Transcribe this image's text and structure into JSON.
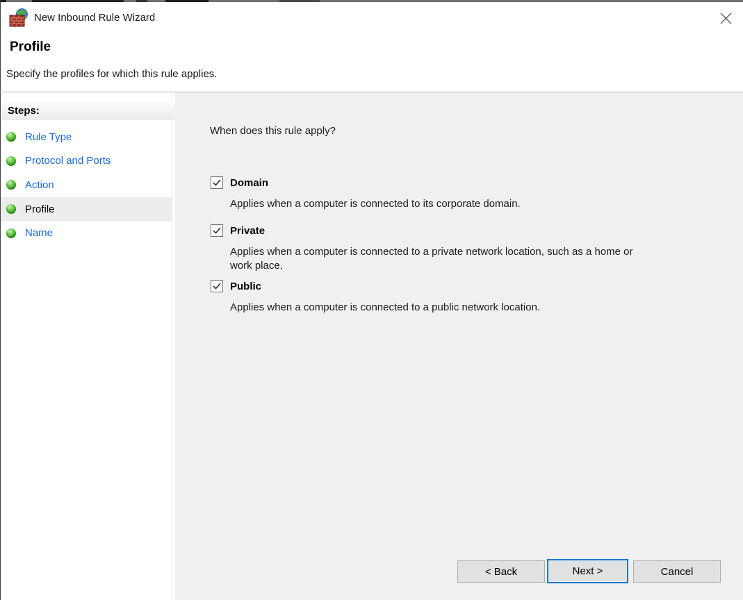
{
  "window": {
    "title": "New Inbound Rule Wizard"
  },
  "header": {
    "title": "Profile",
    "subtitle": "Specify the profiles for which this rule applies."
  },
  "sidebar": {
    "heading": "Steps:",
    "active_step": "Profile",
    "steps": [
      {
        "label": "Rule Type"
      },
      {
        "label": "Protocol and Ports"
      },
      {
        "label": "Action"
      },
      {
        "label": "Profile"
      },
      {
        "label": "Name"
      }
    ]
  },
  "content": {
    "question": "When does this rule apply?",
    "profiles": [
      {
        "label": "Domain",
        "checked": true,
        "description": "Applies when a computer is connected to its corporate domain."
      },
      {
        "label": "Private",
        "checked": true,
        "description": "Applies when a computer is connected to a private network location, such as a home or work place."
      },
      {
        "label": "Public",
        "checked": true,
        "description": "Applies when a computer is connected to a public network location."
      }
    ]
  },
  "footer": {
    "back_label": "< Back",
    "next_label": "Next >",
    "cancel_label": "Cancel"
  },
  "colors": {
    "accent_focus": "#0078d7",
    "link_blue": "#1766d1",
    "step_active_bg": "#ededed",
    "panel_bg": "#f0f0f0",
    "button_bg": "#e1e1e1",
    "button_border": "#adadad",
    "bullet_green": "#39a424"
  }
}
